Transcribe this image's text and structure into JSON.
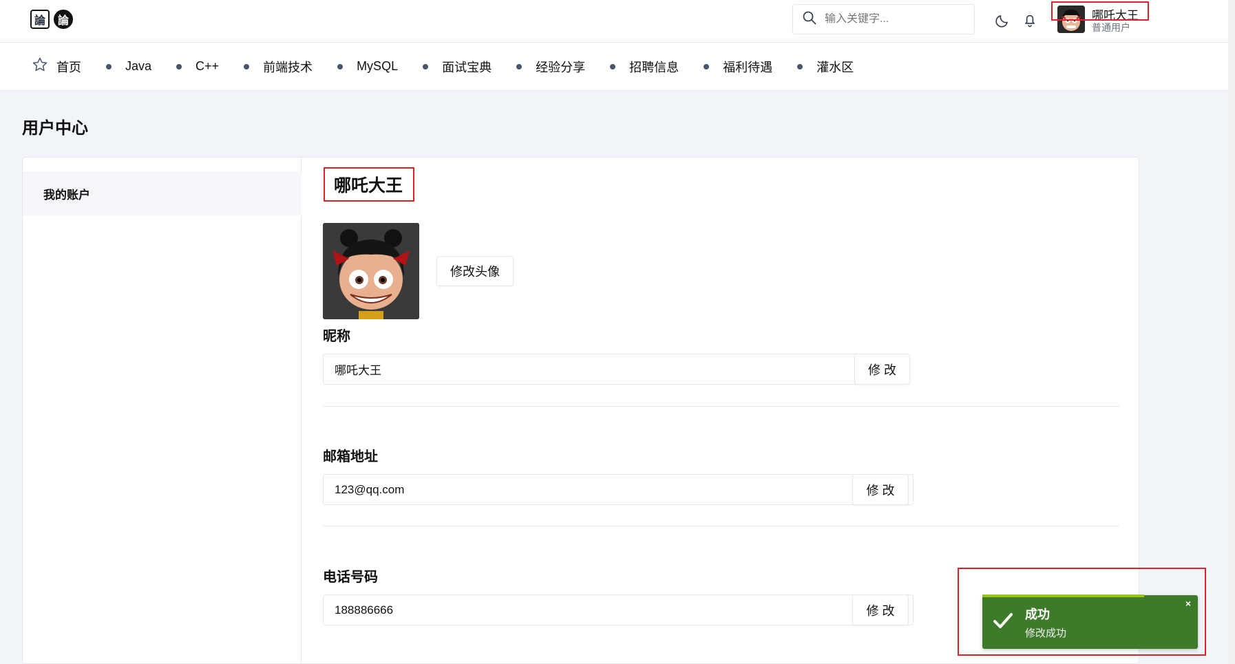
{
  "header": {
    "logo_chars": [
      "論",
      "論"
    ],
    "search_placeholder": "输入关键字...",
    "user_name": "哪吒大王",
    "user_role": "普通用户"
  },
  "nav": {
    "home": "首页",
    "items": [
      "Java",
      "C++",
      "前端技术",
      "MySQL",
      "面试宝典",
      "经验分享",
      "招聘信息",
      "福利待遇",
      "灌水区"
    ]
  },
  "page_title": "用户中心",
  "sidebar": {
    "item": "我的账户"
  },
  "profile": {
    "name": "哪吒大王",
    "change_avatar": "修改头像",
    "nickname_label": "昵称",
    "nickname_value": "哪吒大王",
    "email_label": "邮箱地址",
    "email_value": "123@qq.com",
    "phone_label": "电话号码",
    "phone_value": "188886666",
    "modify_label": "修 改"
  },
  "toast": {
    "title": "成功",
    "message": "修改成功",
    "close": "×",
    "color": "#3d7a2a",
    "progress_color": "#9bc41b"
  }
}
